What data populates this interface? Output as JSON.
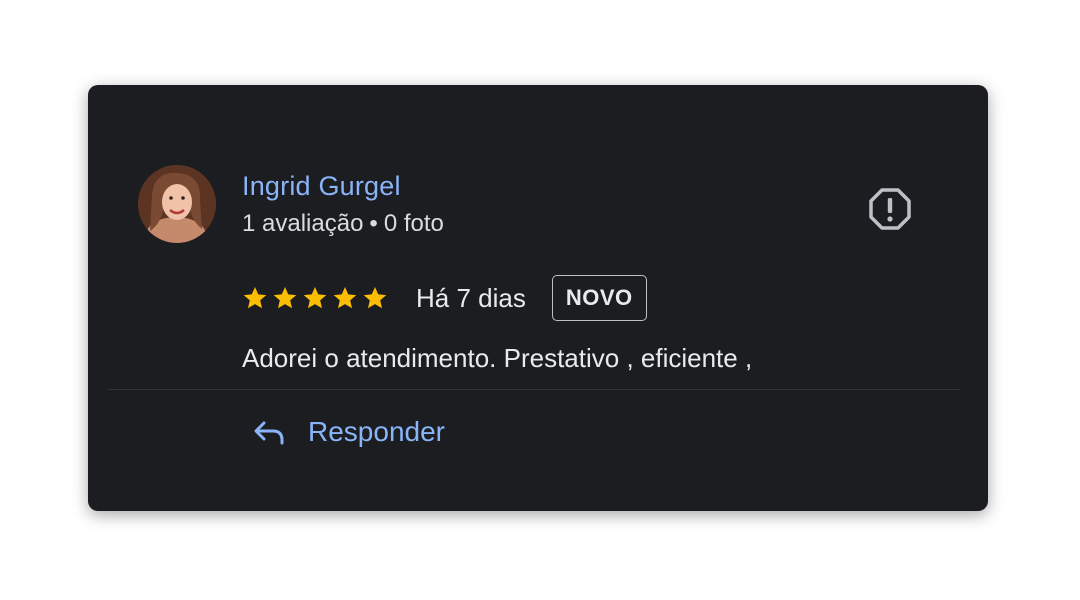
{
  "review": {
    "author_name": "Ingrid Gurgel",
    "reviews_count": "1 avaliação",
    "separator": "•",
    "photos_count": "0 foto",
    "rating": 5,
    "rating_max": 5,
    "date": "Há 7 dias",
    "badge": "NOVO",
    "text": "Adorei o atendimento. Prestativo , eficiente ,",
    "reply_label": "Responder"
  },
  "icons": {
    "report": "report-octagon-icon",
    "star": "star-icon",
    "reply": "reply-arrow-icon"
  },
  "colors": {
    "card_background": "#1c1d21",
    "accent_blue": "#8ab4f8",
    "star_yellow": "#fbbc04",
    "text_primary": "#e8eaed"
  }
}
